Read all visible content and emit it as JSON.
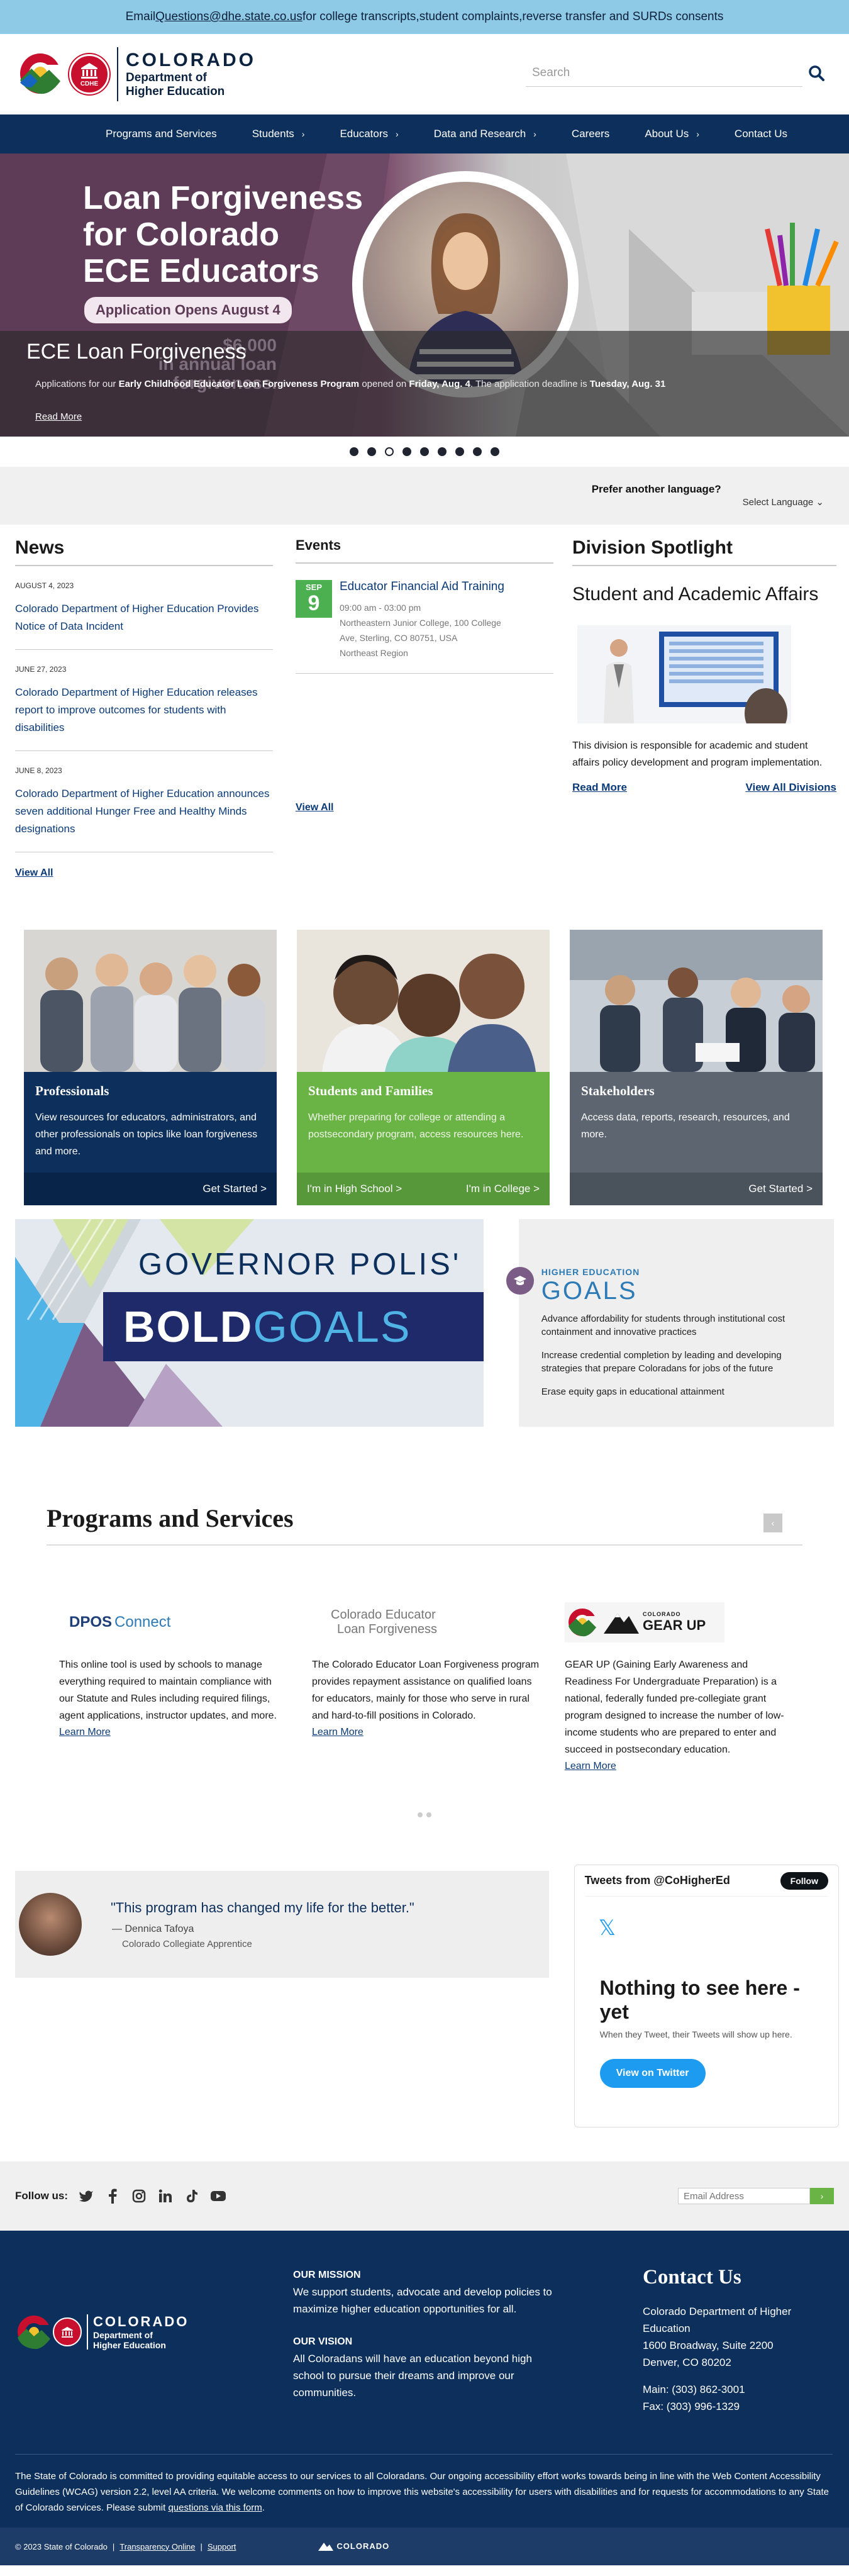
{
  "banner": {
    "prefix": "Email ",
    "email": "Questions@dhe.state.co.us",
    "suffix": " for college transcripts,student complaints,reverse transfer and SURDs consents"
  },
  "header": {
    "logo_badge": "CDHE",
    "logo_state": "COLORADO",
    "logo_dept_line1": "Department of",
    "logo_dept_line2": "Higher Education",
    "search_placeholder": "Search"
  },
  "nav": [
    {
      "label": "Programs and Services",
      "chev": ""
    },
    {
      "label": "Students",
      "chev": "›"
    },
    {
      "label": "Educators",
      "chev": "›"
    },
    {
      "label": "Data and Research",
      "chev": "›"
    },
    {
      "label": "Careers",
      "chev": ""
    },
    {
      "label": "About Us",
      "chev": "›"
    },
    {
      "label": "Contact Us",
      "chev": ""
    }
  ],
  "hero": {
    "headline_1": "Loan Forgiveness",
    "headline_2": "for Colorado",
    "headline_3": "ECE Educators",
    "pill": "Application Opens August 4",
    "ghost_1": "$6,000",
    "ghost_2": "in annual loan forgiveness.",
    "title": "ECE Loan Forgiveness",
    "desc_1": "Applications for our ",
    "desc_b1": "Early Childhood Educator Loan Forgiveness Program",
    "desc_2": " opened on ",
    "desc_b2": "Friday, Aug. 4",
    "desc_3": ". The application deadline is ",
    "desc_b3": "Tuesday, Aug. 31",
    "read_more": "Read More"
  },
  "carousel": {
    "count": 9,
    "active": 2
  },
  "language": {
    "label": "Prefer another language?",
    "select": "Select Language ⌄"
  },
  "news": {
    "heading": "News",
    "items": [
      {
        "date": "AUGUST 4, 2023",
        "title": "Colorado Department of Higher Education Provides Notice of Data Incident"
      },
      {
        "date": "JUNE 27, 2023",
        "title": "Colorado Department of Higher Education releases report to improve outcomes for students with disabilities"
      },
      {
        "date": "JUNE 8, 2023",
        "title": "Colorado Department of Higher Education announces seven additional Hunger Free and Healthy Minds designations"
      }
    ],
    "view_all": "View All"
  },
  "events": {
    "heading": "Events",
    "month": "SEP",
    "day": "9",
    "title": "Educator Financial Aid Training",
    "time": "09:00 am - 03:00 pm",
    "location_1": "Northeastern Junior College, 100 College",
    "location_2": "Ave, Sterling, CO 80751, USA",
    "region": "Northeast Region",
    "view_all": "View All"
  },
  "spotlight": {
    "heading": "Division Spotlight",
    "title": "Student and Academic Affairs",
    "desc": "This division is responsible for academic and student affairs policy development and program implementation.",
    "read_more": "Read More",
    "view_all": "View All Divisions"
  },
  "cards": [
    {
      "title": "Professionals",
      "desc": "View resources for educators, administrators, and other professionals on topics like loan forgiveness and more.",
      "cta": "Get Started >"
    },
    {
      "title": "Students and Families",
      "desc": "Whether preparing for college or attending a postsecondary program, access resources here.",
      "cta_left": "I'm in High School >",
      "cta_right": "I'm in College >"
    },
    {
      "title": "Stakeholders",
      "desc": "Access data, reports, research, resources, and more.",
      "cta": "Get Started >"
    }
  ],
  "goals": {
    "governor": "GOVERNOR POLIS'",
    "bold": "BOLD",
    "goals": "GOALS",
    "hed_label": "HIGHER EDUCATION",
    "hed_goals": "GOALS",
    "items": [
      "Advance affordability for students through institutional cost containment and innovative practices",
      "Increase credential completion by leading and developing strategies that prepare Coloradans for jobs of the future",
      "Erase equity gaps in educational attainment"
    ]
  },
  "programs": {
    "heading": "Programs and Services",
    "items": [
      {
        "logo_a": "DPOS",
        "logo_b": "Connect",
        "desc": "This online tool is used by schools to manage everything required to maintain compliance with our Statute and Rules including required filings, agent applications, instructor updates, and more.",
        "link": "Learn More"
      },
      {
        "logo_a": "Colorado Educator",
        "logo_b": "Loan Forgiveness",
        "desc": "The Colorado Educator Loan Forgiveness program provides repayment assistance on qualified loans for educators, mainly for those who serve in rural and hard-to-fill positions in Colorado.",
        "link": "Learn More"
      },
      {
        "logo_a": "COLORADO",
        "logo_b": "GEAR UP",
        "desc": "GEAR UP (Gaining Early Awareness and Readiness For Undergraduate Preparation) is a national, federally funded pre-collegiate grant program designed to increase the number of low-income students who are prepared to enter and succeed in postsecondary education.",
        "link": "Learn More"
      }
    ]
  },
  "testimonial": {
    "quote": "\"This program has changed my life for the better.\"",
    "name": "— Dennica Tafoya",
    "role": "Colorado Collegiate Apprentice"
  },
  "twitter": {
    "heading": "Tweets from @CoHigherEd",
    "follow": "Follow",
    "empty_title": "Nothing to see here - yet",
    "empty_sub": "When they Tweet, their Tweets will show up here.",
    "view_btn": "View on Twitter"
  },
  "follow": {
    "label": "Follow us:",
    "email_placeholder": "Email Address",
    "go": "›"
  },
  "footer": {
    "logo_state": "COLORADO",
    "logo_dept_1": "Department of",
    "logo_dept_2": "Higher Education",
    "mission_h": "OUR MISSION",
    "mission": "We support students, advocate and develop policies to maximize higher education opportunities for all.",
    "vision_h": "OUR VISION",
    "vision": "All Coloradans will have an education beyond high school to pursue their dreams and improve our communities.",
    "contact_h": "Contact Us",
    "contact_name": "Colorado Department of Higher Education",
    "address_1": "1600 Broadway, Suite 2200",
    "address_2": "Denver, CO 80202",
    "main": "Main: (303) 862-3001",
    "fax": "Fax: (303) 996-1329",
    "access": "The State of Colorado is committed to providing equitable access to our services to all Coloradans. Our ongoing accessibility effort works towards being in line with the Web Content Accessibility Guidelines (WCAG) version 2.2, level AA criteria. We welcome comments on how to improve this website's accessibility for users with disabilities and for requests for accommodations to any State of Colorado services. Please submit ",
    "access_link": "questions via this form",
    "access_end": ".",
    "copyright": "© 2023 State of Colorado",
    "transparency": "Transparency Online",
    "support": "Support",
    "mini_logo": "COLORADO"
  }
}
